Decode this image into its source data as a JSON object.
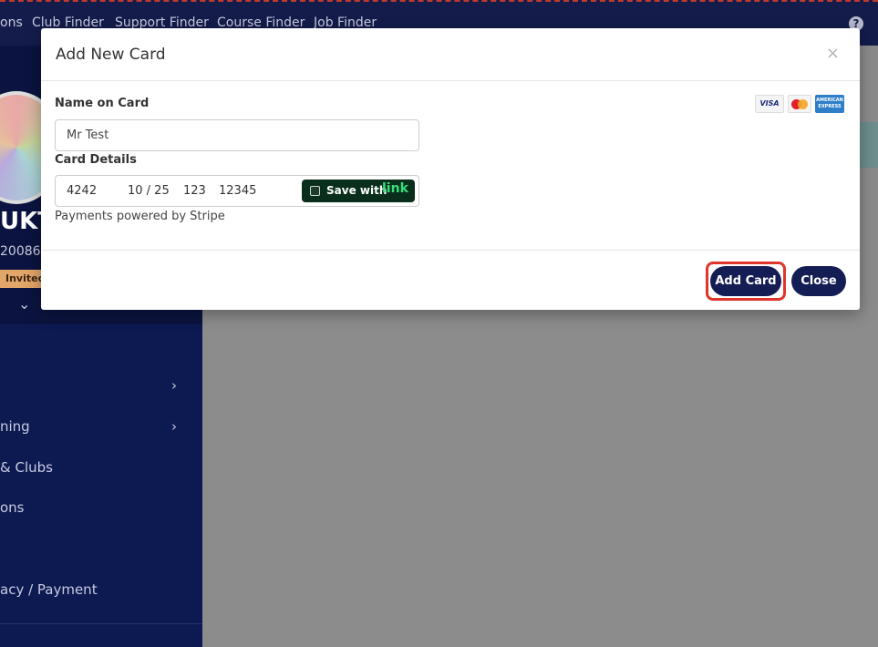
{
  "topnav": {
    "links": [
      "ons",
      "Club Finder",
      "Support Finder",
      "Course Finder",
      "Job Finder"
    ],
    "help_glyph": "?"
  },
  "profile": {
    "name": "UKT",
    "id": "20086",
    "badge": "Invited"
  },
  "sidebar": {
    "items": [
      {
        "label": ""
      },
      {
        "label": "ning"
      },
      {
        "label": "& Clubs"
      },
      {
        "label": "ons"
      },
      {
        "label": "acy / Payment"
      }
    ]
  },
  "modal": {
    "title": "Add New Card",
    "close_glyph": "×",
    "name_label": "Name on Card",
    "name_value": "Mr Test",
    "card_label": "Card Details",
    "card_number": "4242",
    "card_expiry": "10 / 25",
    "card_cvc": "123",
    "card_zip": "12345",
    "link_label": "Save with",
    "link_brand": "link",
    "powered_by": "Payments powered by Stripe",
    "card_logos": {
      "visa": "VISA",
      "amex": "AMERICAN EXPRESS"
    },
    "add_button": "Add Card",
    "close_button": "Close"
  },
  "colors": {
    "nav_bg": "#141c4c",
    "sidebar_bg": "#0d1a52",
    "primary_button": "#151d55",
    "highlight": "#e0352b",
    "link_green": "#33e07a"
  },
  "icons": {
    "help": "help-circle-icon",
    "chevron": "chevron-right-icon",
    "close": "close-icon"
  }
}
